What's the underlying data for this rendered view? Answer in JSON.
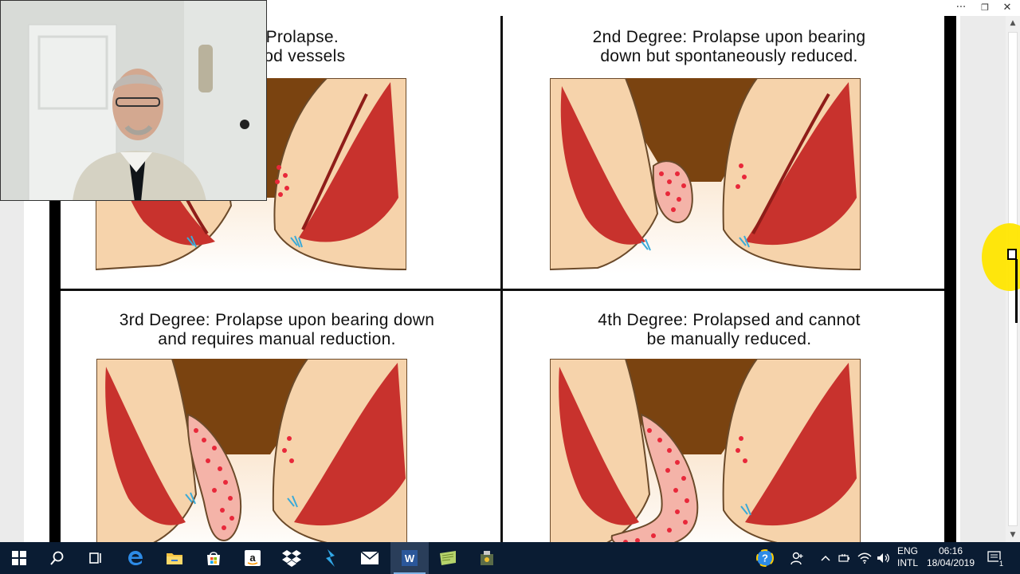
{
  "window": {
    "more_glyph": "···",
    "restore_glyph": "❐",
    "close_glyph": "✕"
  },
  "slide": {
    "panels": [
      {
        "line1": "No Prolapse.",
        "line2": "t blood vessels"
      },
      {
        "line1": "2nd Degree: Prolapse upon bearing",
        "line2": "down but spontaneously reduced."
      },
      {
        "line1": "3rd Degree: Prolapse upon bearing down",
        "line2": "and requires manual reduction."
      },
      {
        "line1": "4th Degree: Prolapsed and cannot",
        "line2": "be manually reduced."
      }
    ]
  },
  "scrollbar": {
    "up_glyph": "▲",
    "down_glyph": "▼"
  },
  "taskbar": {
    "items": [
      "start",
      "search",
      "task-view",
      "edge",
      "file-explorer",
      "store",
      "amazon",
      "dropbox",
      "sway",
      "mail",
      "word",
      "notes",
      "unknown-app"
    ],
    "active_item": "word"
  },
  "tray": {
    "lang_line1": "ENG",
    "lang_line2": "INTL",
    "time": "06:16",
    "date": "18/04/2019",
    "notification_count": "1"
  },
  "colors": {
    "taskbar": "#0a1c33",
    "muscle": "#c8322d",
    "skin": "#f6d3ab",
    "lumen": "#7a4310",
    "highlight": "#ffe600"
  }
}
